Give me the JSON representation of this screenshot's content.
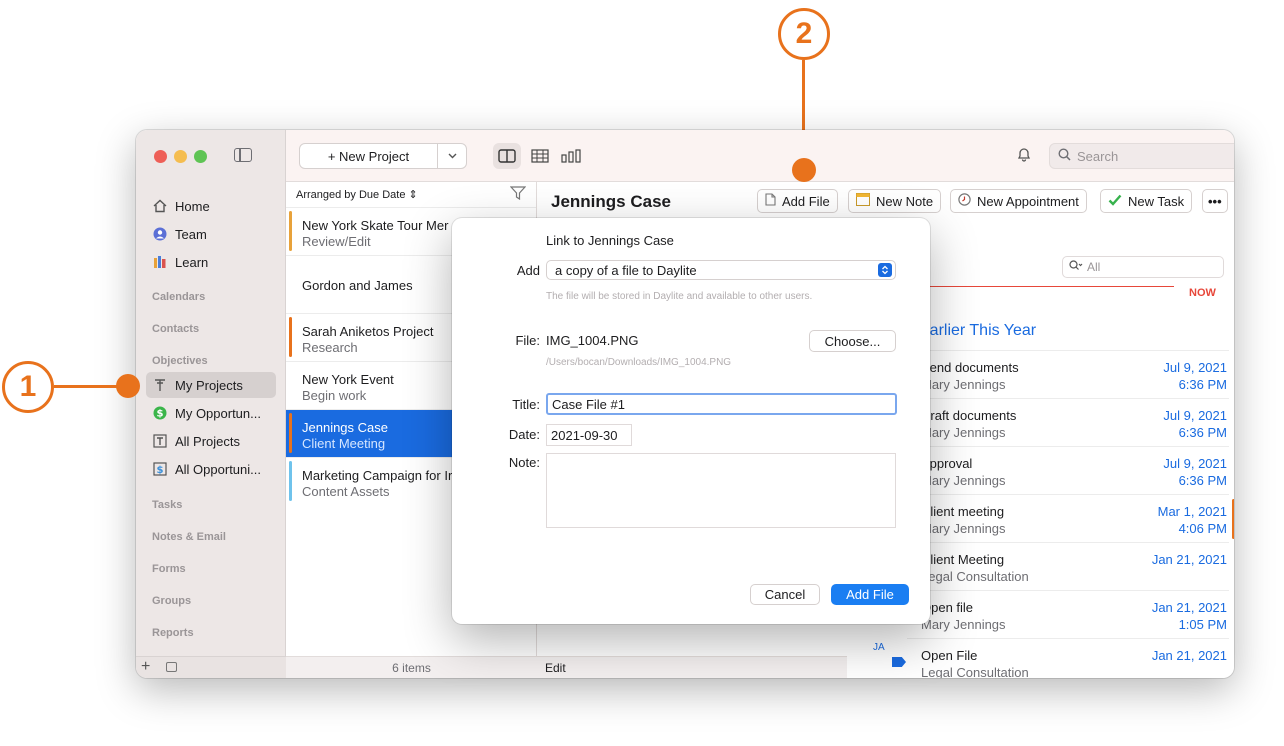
{
  "callouts": {
    "one": "1",
    "two": "2"
  },
  "toolbar": {
    "new_project_label": "+ New Project",
    "search_placeholder": "Search"
  },
  "sidebar": {
    "items": [
      {
        "label": "Home",
        "icon": "home-icon"
      },
      {
        "label": "Team",
        "icon": "team-icon"
      },
      {
        "label": "Learn",
        "icon": "learn-icon"
      }
    ],
    "sections": [
      "Calendars",
      "Contacts",
      "Objectives",
      "Tasks",
      "Notes & Email",
      "Forms",
      "Groups",
      "Reports"
    ],
    "objectives": [
      {
        "label": "My Projects",
        "icon": "projects-icon",
        "selected": true
      },
      {
        "label": "My Opportun...",
        "icon": "dollar-icon"
      },
      {
        "label": "All Projects",
        "icon": "all-projects-icon"
      },
      {
        "label": "All Opportuni...",
        "icon": "all-opportunities-icon"
      }
    ]
  },
  "list": {
    "sort_label": "Arranged by Due Date",
    "rows": [
      {
        "title": "New York Skate Tour Mer",
        "subtitle": "Review/Edit",
        "bar_color": "#e8a23a"
      },
      {
        "title": "Gordon and James",
        "subtitle": "",
        "bar_color": ""
      },
      {
        "title": "Sarah Aniketos Project",
        "subtitle": "Research",
        "bar_color": "#e8721c"
      },
      {
        "title": "New York Event",
        "subtitle": "Begin work",
        "bar_color": ""
      },
      {
        "title": "Jennings Case",
        "subtitle": "Client Meeting",
        "bar_color": "#e8721c",
        "selected": true
      },
      {
        "title": "Marketing Campaign for Ir",
        "subtitle": "Content Assets",
        "bar_color": "#6fc3ec"
      }
    ],
    "count_label": "6 items"
  },
  "detail": {
    "title": "Jennings Case",
    "actions": {
      "add_file": "Add File",
      "new_note": "New Note",
      "new_appointment": "New Appointment",
      "new_task": "New Task",
      "more": "•••"
    },
    "footer_label": "Edit"
  },
  "timeline": {
    "filter_placeholder": "All",
    "now_label": "NOW",
    "section_title": "Earlier This Year",
    "month_label": "JA",
    "rows": [
      {
        "title": "Send documents",
        "subtitle": "Mary Jennings",
        "date": "Jul 9, 2021",
        "time": "6:36 PM"
      },
      {
        "title": "Draft documents",
        "subtitle": "Mary Jennings",
        "date": "Jul 9, 2021",
        "time": "6:36 PM"
      },
      {
        "title": "Approval",
        "subtitle": "Mary Jennings",
        "date": "Jul 9, 2021",
        "time": "6:36 PM"
      },
      {
        "title": "Client meeting",
        "subtitle": "Mary Jennings",
        "date": "Mar 1, 2021",
        "time": "4:06 PM",
        "accent": true
      },
      {
        "title": "Client Meeting",
        "subtitle": "Legal Consultation",
        "date": "Jan 21, 2021",
        "time": ""
      },
      {
        "title": "Open file",
        "subtitle": "Mary Jennings",
        "date": "Jan 21, 2021",
        "time": "1:05 PM"
      },
      {
        "title": "Open File",
        "subtitle": "Legal Consultation",
        "date": "Jan 21, 2021",
        "time": ""
      }
    ]
  },
  "dialog": {
    "title": "Link to Jennings Case",
    "add_label": "Add",
    "add_option": "a copy of a file to Daylite",
    "add_hint": "The file will be stored in Daylite and available to other users.",
    "file_label": "File:",
    "file_name": "IMG_1004.PNG",
    "file_path": "/Users/bocan/Downloads/IMG_1004.PNG",
    "choose_label": "Choose...",
    "title_label": "Title:",
    "title_value": "Case File #1",
    "date_label": "Date:",
    "date_value": "2021-09-30",
    "note_label": "Note:",
    "cancel_label": "Cancel",
    "add_file_label": "Add File"
  },
  "colors": {
    "accent": "#1a6be0",
    "callout": "#e8721c"
  }
}
